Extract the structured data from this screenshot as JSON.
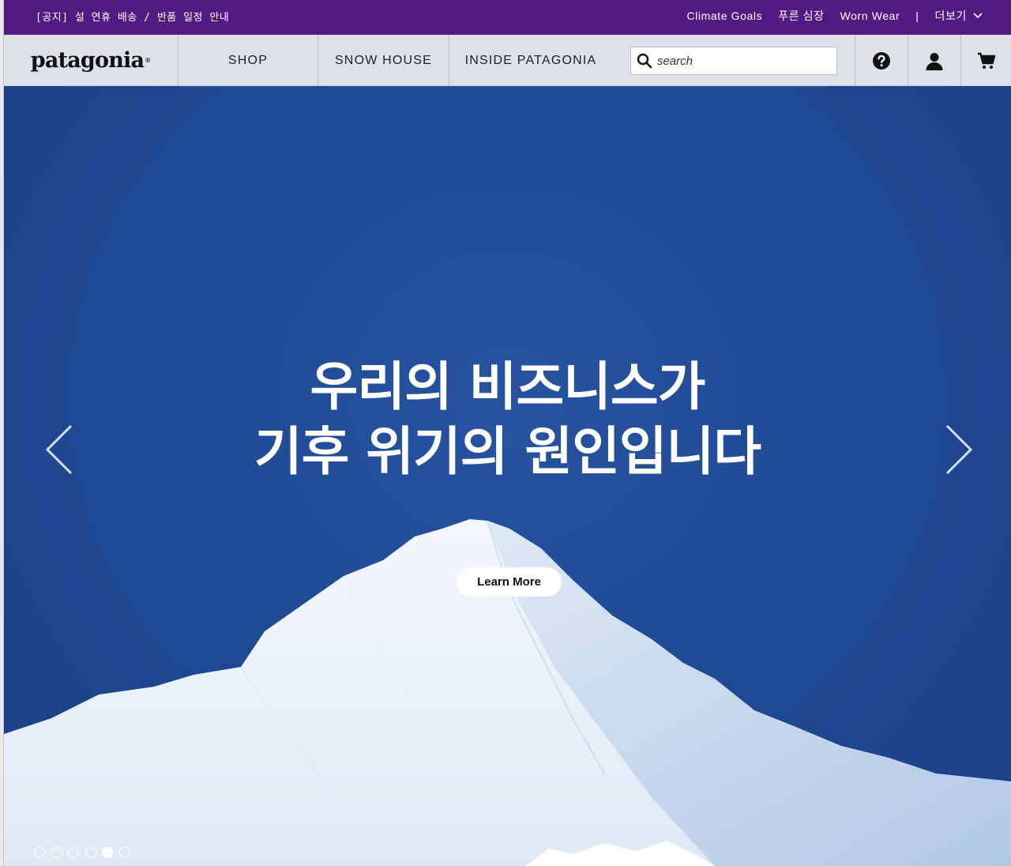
{
  "topbar": {
    "notice": "[공지] 설 연휴 배송 / 반품 일정 안내",
    "links": [
      "Climate Goals",
      "푸른 심장",
      "Worn Wear"
    ],
    "separator": "|",
    "more_label": "더보기"
  },
  "nav": {
    "logo": "patagonia",
    "items": [
      "SHOP",
      "SNOW HOUSE",
      "INSIDE PATAGONIA"
    ],
    "search_placeholder": "search",
    "icons": [
      "help-icon",
      "account-icon",
      "cart-icon"
    ]
  },
  "hero": {
    "headline_line1": "우리의 비즈니스가",
    "headline_line2": "기후 위기의 원인입니다",
    "cta_label": "Learn More",
    "slide_count": 6,
    "active_slide": 5
  },
  "colors": {
    "topbar_bg": "#531a84",
    "nav_bg": "#dde1e8",
    "hero_sky": "#1f4a93"
  }
}
